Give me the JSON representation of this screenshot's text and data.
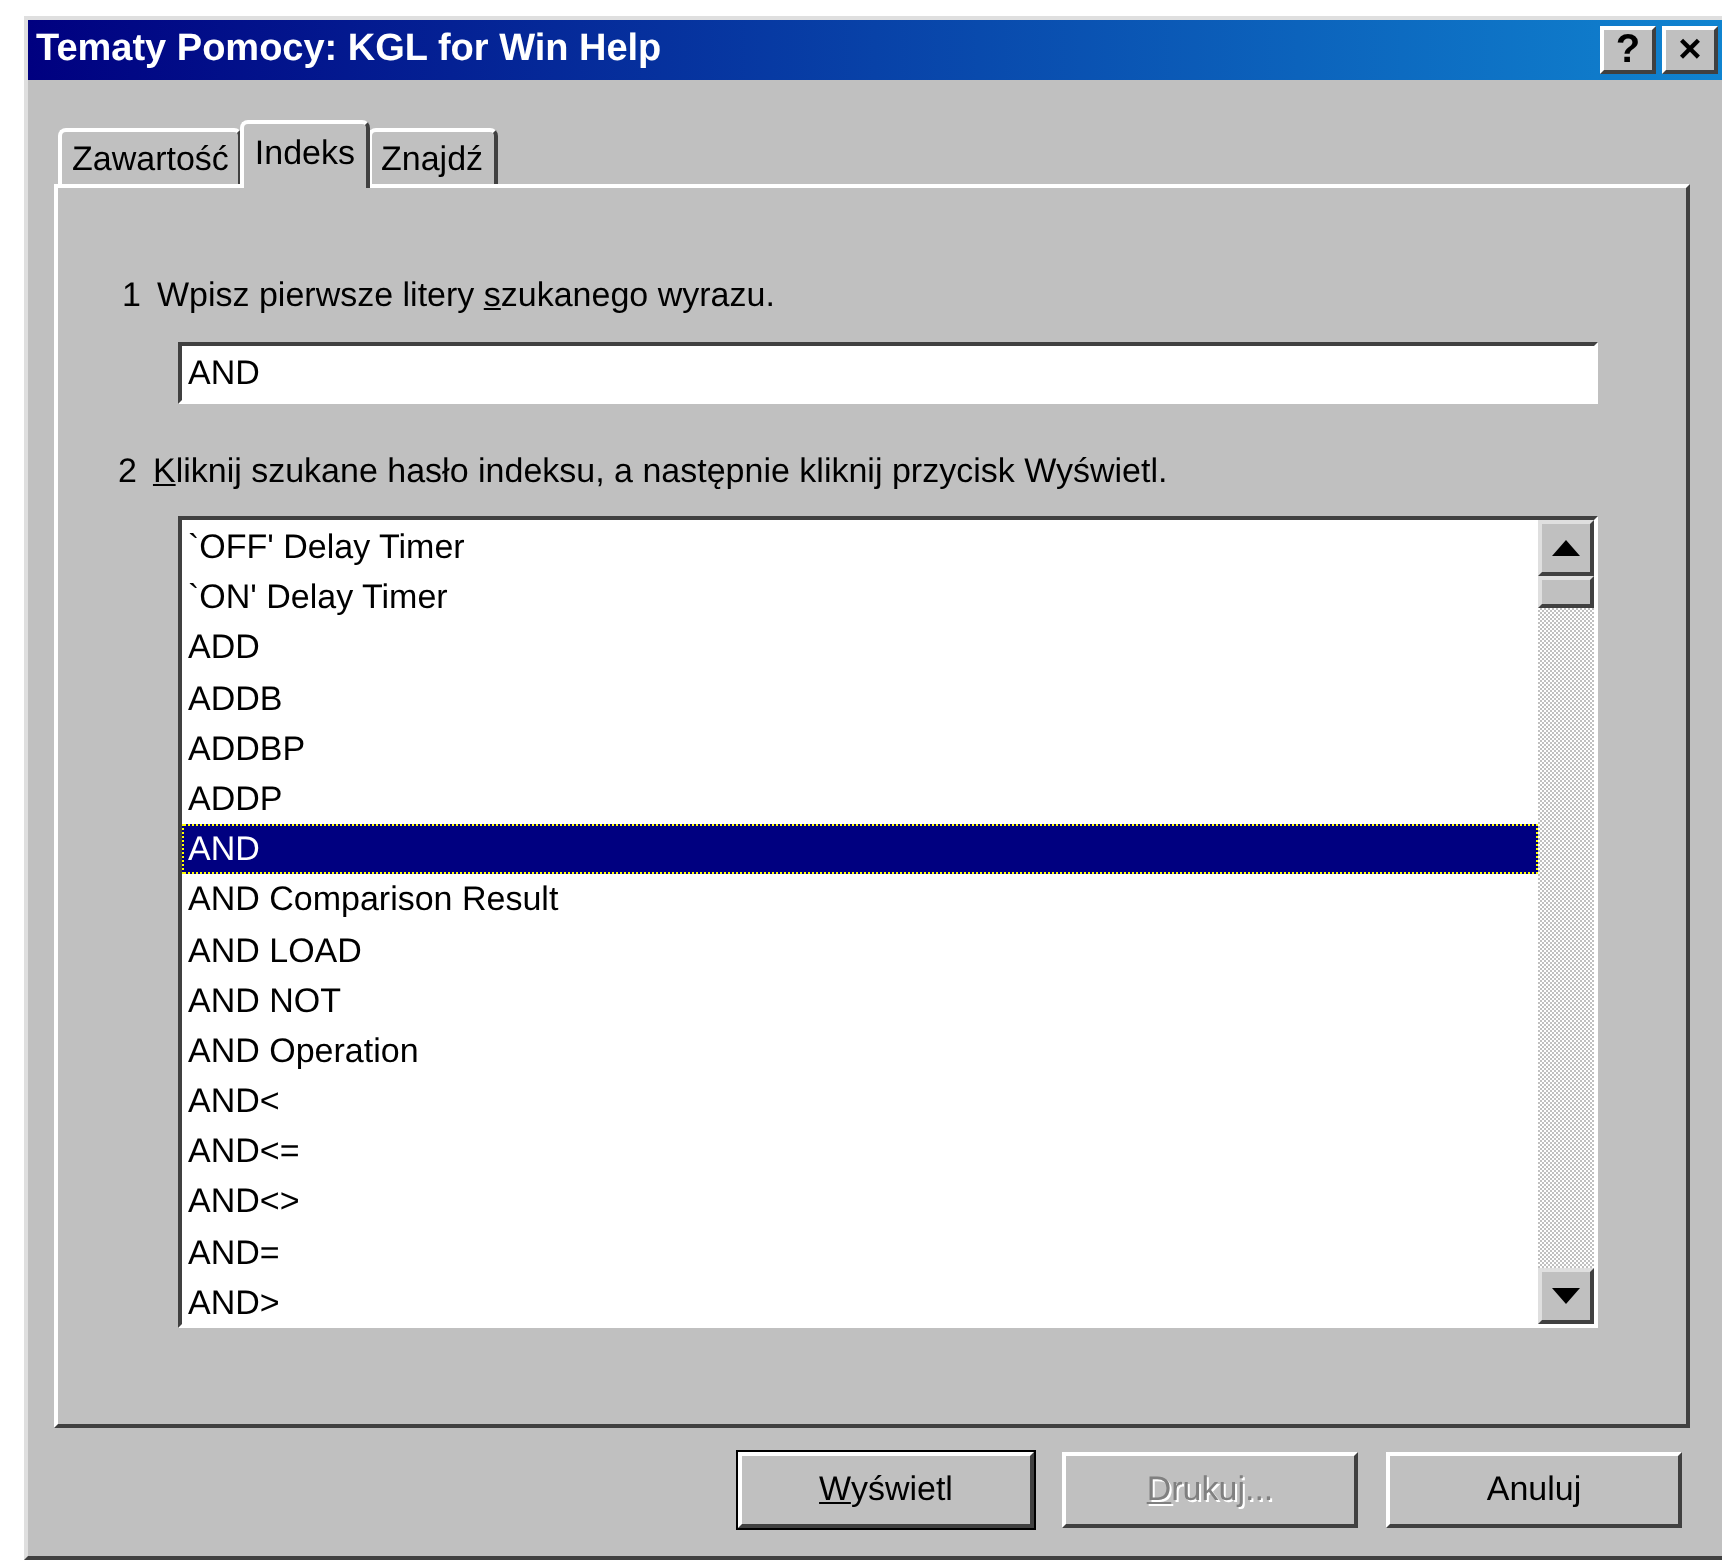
{
  "window": {
    "title": "Tematy Pomocy: KGL for Win Help",
    "title_buttons": [
      {
        "label": "?"
      },
      {
        "label": "×"
      }
    ]
  },
  "tabs": [
    {
      "label": "Zawartość",
      "selected": false
    },
    {
      "label": "Indeks",
      "selected": true
    },
    {
      "label": "Znajdź",
      "selected": false
    }
  ],
  "step_1": {
    "number": "1",
    "label": [
      {
        "text": "Wpisz pierwsze litery ",
        "underlined": false
      },
      {
        "text": "s",
        "underlined": true
      },
      {
        "text": "zukanego wyrazu.",
        "underlined": false
      }
    ]
  },
  "search": {
    "value": "AND"
  },
  "step_2": {
    "number": "2",
    "label": [
      {
        "text": "K",
        "underlined": true
      },
      {
        "text": "liknij szukane hasło indeksu, a następnie kliknij przycisk Wyświetl.",
        "underlined": false
      }
    ]
  },
  "index_list": [
    {
      "label": "`OFF' Delay Timer",
      "selected": false
    },
    {
      "label": "`ON' Delay Timer",
      "selected": false
    },
    {
      "label": "ADD",
      "selected": false
    },
    {
      "label": "ADDB",
      "selected": false
    },
    {
      "label": "ADDBP",
      "selected": false
    },
    {
      "label": "ADDP",
      "selected": false
    },
    {
      "label": "AND",
      "selected": true
    },
    {
      "label": "AND Comparison Result",
      "selected": false
    },
    {
      "label": "AND LOAD",
      "selected": false
    },
    {
      "label": "AND NOT",
      "selected": false
    },
    {
      "label": "AND Operation",
      "selected": false
    },
    {
      "label": "AND<",
      "selected": false
    },
    {
      "label": "AND<=",
      "selected": false
    },
    {
      "label": "AND<>",
      "selected": false
    },
    {
      "label": "AND=",
      "selected": false
    },
    {
      "label": "AND>",
      "selected": false
    }
  ],
  "buttons": [
    {
      "label": [
        {
          "text": "W",
          "underlined": true
        },
        {
          "text": "yświetl",
          "underlined": false
        }
      ],
      "disabled": false,
      "default": true
    },
    {
      "label": [
        {
          "text": "D",
          "underlined": true
        },
        {
          "text": "rukuj...",
          "underlined": false
        }
      ],
      "disabled": true,
      "default": false
    },
    {
      "label": [
        {
          "text": "Anuluj",
          "underlined": false
        }
      ],
      "disabled": false,
      "default": false
    }
  ]
}
